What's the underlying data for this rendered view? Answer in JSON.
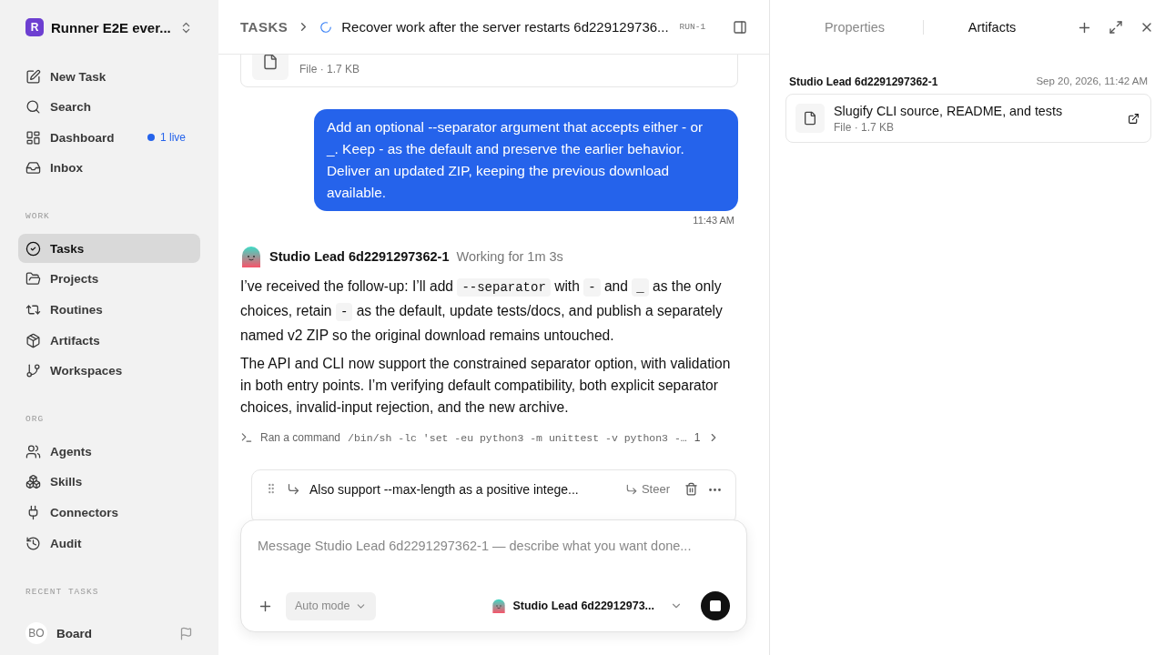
{
  "workspace": {
    "initial": "R",
    "name": "Runner E2E ever..."
  },
  "sidebar": {
    "top_items": [
      {
        "label": "New Task",
        "selected": false
      },
      {
        "label": "Search",
        "selected": false
      },
      {
        "label": "Dashboard",
        "selected": false,
        "badge": "1 live"
      },
      {
        "label": "Inbox",
        "selected": false
      }
    ],
    "sections": [
      {
        "title": "WORK",
        "items": [
          {
            "label": "Tasks",
            "selected": true
          },
          {
            "label": "Projects",
            "selected": false
          },
          {
            "label": "Routines",
            "selected": false
          },
          {
            "label": "Artifacts",
            "selected": false
          },
          {
            "label": "Workspaces",
            "selected": false
          }
        ]
      },
      {
        "title": "ORG",
        "items": [
          {
            "label": "Agents",
            "selected": false
          },
          {
            "label": "Skills",
            "selected": false
          },
          {
            "label": "Connectors",
            "selected": false
          },
          {
            "label": "Audit",
            "selected": false
          }
        ]
      },
      {
        "title": "RECENT TASKS"
      }
    ],
    "user": {
      "initials": "BO",
      "name": "Board"
    }
  },
  "header": {
    "breadcrumb": "TASKS",
    "title": "Recover work after the server restarts 6d229129736...",
    "run": "RUN-1"
  },
  "messages": [
    {
      "kind": "file",
      "meta": "File · 1.7 KB"
    },
    {
      "kind": "user",
      "text": "Add an optional --separator argument that accepts either - or _. Keep - as the default and preserve the earlier behavior. Deliver an updated ZIP, keeping the previous download available.",
      "time": "11:43 AM"
    },
    {
      "kind": "agent",
      "name": "Studio Lead 6d2291297362-1",
      "status": "Working for 1m 3s",
      "paragraphs": [
        [
          {
            "kind": "text",
            "text": "I’ve received the follow-up: I’ll add "
          },
          {
            "kind": "code",
            "text": "--separator"
          },
          {
            "kind": "text",
            "text": " with "
          },
          {
            "kind": "code",
            "text": "-"
          },
          {
            "kind": "text",
            "text": " and "
          },
          {
            "kind": "code",
            "text": "_"
          },
          {
            "kind": "text",
            "text": " as the only choices, retain "
          },
          {
            "kind": "code",
            "text": "-"
          },
          {
            "kind": "text",
            "text": " as the default, update tests/docs, and publish a separately named v2 ZIP so the original download remains untouched."
          }
        ],
        [
          {
            "kind": "text",
            "text": "The API and CLI now support the constrained separator option, with validation in both entry points. I’m verifying default compatibility, both explicit separator choices, invalid-input rejection, and the new archive."
          }
        ]
      ],
      "command": {
        "label": "Ran a command",
        "code": "/bin/sh -lc 'set -eu python3 -m unittest -v python3 -…",
        "count": "1"
      }
    }
  ],
  "queued": {
    "text": "Also support --max-length as a positive intege...",
    "action": "Steer"
  },
  "composer": {
    "placeholder": "Message Studio Lead 6d2291297362-1 — describe what you want done...",
    "mode": "Auto mode",
    "agent": "Studio Lead 6d22912973..."
  },
  "panel": {
    "tabs": [
      {
        "label": "Properties",
        "selected": false
      },
      {
        "label": "Artifacts",
        "selected": true
      }
    ],
    "group": {
      "author": "Studio Lead 6d2291297362-1",
      "date": "Sep 20, 2026, 11:42 AM"
    },
    "artifacts": [
      {
        "title": "Slugify CLI source, README, and tests",
        "meta": "File · 1.7 KB"
      }
    ]
  }
}
